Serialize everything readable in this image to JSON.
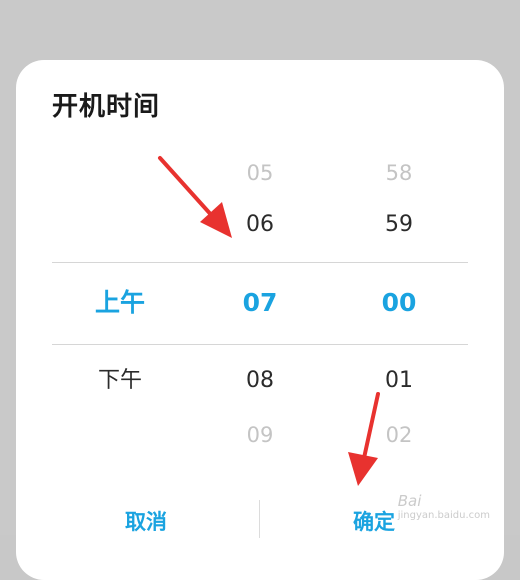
{
  "dialog": {
    "title": "开机时间",
    "picker": {
      "period": {
        "items": [
          "",
          "",
          "上午",
          "下午",
          ""
        ],
        "selected": "上午"
      },
      "hour": {
        "items": [
          "05",
          "06",
          "07",
          "08",
          "09"
        ],
        "selected": "07"
      },
      "minute": {
        "items": [
          "58",
          "59",
          "00",
          "01",
          "02"
        ],
        "selected": "00"
      }
    },
    "buttons": {
      "cancel_label": "取消",
      "confirm_label": "确定"
    }
  },
  "colors": {
    "accent": "#1aa3e0",
    "arrow": "#e8322f"
  },
  "watermark": {
    "text": "Bai",
    "sub": "jingyan.baidu.com"
  }
}
